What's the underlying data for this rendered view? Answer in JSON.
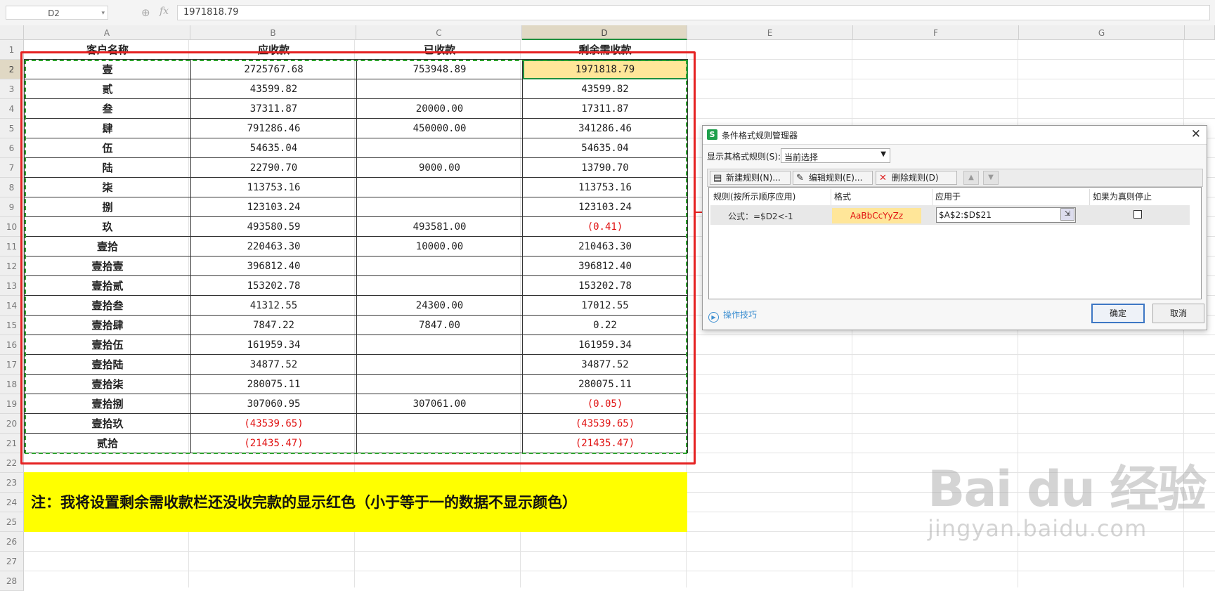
{
  "formula_bar": {
    "cell_ref": "D2",
    "fx": "fx",
    "value": "1971818.79"
  },
  "columns": [
    "A",
    "B",
    "C",
    "D",
    "E",
    "F",
    "G"
  ],
  "row_numbers": [
    "1",
    "2",
    "3",
    "4",
    "5",
    "6",
    "7",
    "8",
    "9",
    "10",
    "11",
    "12",
    "13",
    "14",
    "15",
    "16",
    "17",
    "18",
    "19",
    "20",
    "21",
    "22",
    "23",
    "24",
    "25",
    "26",
    "27",
    "28"
  ],
  "table": {
    "headers": [
      "客户名称",
      "应收款",
      "已收款",
      "剩余需收款"
    ],
    "rows": [
      [
        "壹",
        "2725767.68",
        "753948.89",
        "1971818.79"
      ],
      [
        "贰",
        "43599.82",
        "",
        "43599.82"
      ],
      [
        "叁",
        "37311.87",
        "20000.00",
        "17311.87"
      ],
      [
        "肆",
        "791286.46",
        "450000.00",
        "341286.46"
      ],
      [
        "伍",
        "54635.04",
        "",
        "54635.04"
      ],
      [
        "陆",
        "22790.70",
        "9000.00",
        "13790.70"
      ],
      [
        "柒",
        "113753.16",
        "",
        "113753.16"
      ],
      [
        "捌",
        "123103.24",
        "",
        "123103.24"
      ],
      [
        "玖",
        "493580.59",
        "493581.00",
        "(0.41)"
      ],
      [
        "壹拾",
        "220463.30",
        "10000.00",
        "210463.30"
      ],
      [
        "壹拾壹",
        "396812.40",
        "",
        "396812.40"
      ],
      [
        "壹拾贰",
        "153202.78",
        "",
        "153202.78"
      ],
      [
        "壹拾叁",
        "41312.55",
        "24300.00",
        "17012.55"
      ],
      [
        "壹拾肆",
        "7847.22",
        "7847.00",
        "0.22"
      ],
      [
        "壹拾伍",
        "161959.34",
        "",
        "161959.34"
      ],
      [
        "壹拾陆",
        "34877.52",
        "",
        "34877.52"
      ],
      [
        "壹拾柒",
        "280075.11",
        "",
        "280075.11"
      ],
      [
        "壹拾捌",
        "307060.95",
        "307061.00",
        "(0.05)"
      ],
      [
        "壹拾玖",
        "(43539.65)",
        "",
        "(43539.65)"
      ],
      [
        "贰拾",
        "(21435.47)",
        "",
        "(21435.47)"
      ]
    ]
  },
  "note": "注：我将设置剩余需收款栏还没收完款的显示红色（小于等于一的数据不显示颜色）",
  "dialog": {
    "title": "条件格式规则管理器",
    "show_rules_label": "显示其格式规则(S):",
    "show_rules_value": "当前选择",
    "buttons": {
      "new": "新建规则(N)...",
      "edit": "编辑规则(E)...",
      "delete": "删除规则(D)"
    },
    "list_headers": {
      "rule": "规则(按所示顺序应用)",
      "format": "格式",
      "applies": "应用于",
      "stop": "如果为真则停止"
    },
    "rule": {
      "formula": "公式：=$D2<-1",
      "preview": "AaBbCcYyZz",
      "applies_to": "$A$2:$D$21"
    },
    "tips": "操作技巧",
    "ok": "确定",
    "cancel": "取消"
  },
  "watermark": {
    "logo": "Bai du 经验",
    "url": "jingyan.baidu.com"
  },
  "colors": {
    "negative": "#e01010",
    "highlight": "#ffe699",
    "note_bg": "#ffff00",
    "frame": "#e52222",
    "selection": "#2ca02c"
  }
}
